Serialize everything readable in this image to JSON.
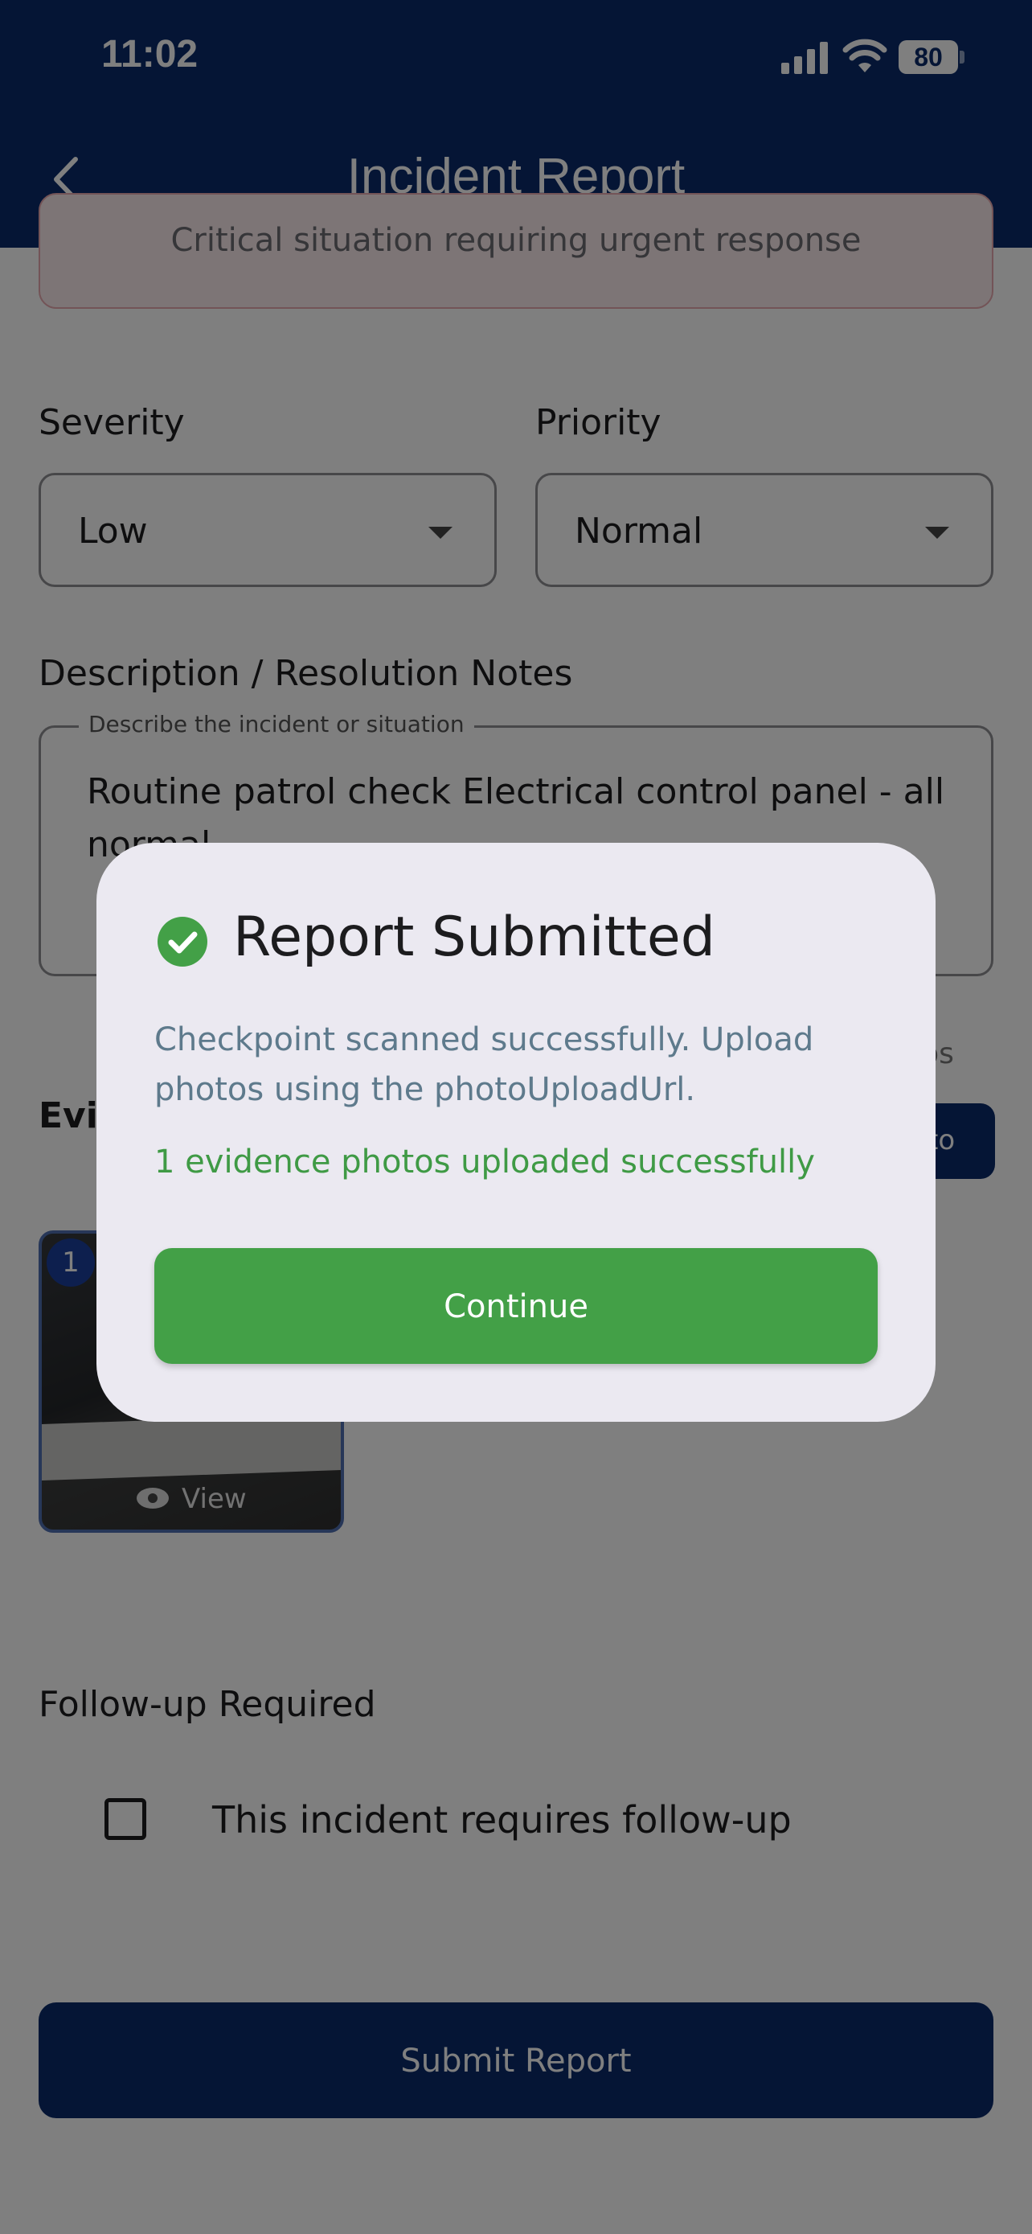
{
  "status_bar": {
    "time": "11:02",
    "battery": "80"
  },
  "header": {
    "title": "Incident Report"
  },
  "incident_type": {
    "description": "Critical situation requiring urgent response"
  },
  "severity": {
    "label": "Severity",
    "value": "Low"
  },
  "priority": {
    "label": "Priority",
    "value": "Normal"
  },
  "description": {
    "label": "Description / Resolution Notes",
    "legend": "Describe the incident or situation",
    "value": "Routine patrol check Electrical control panel - all normal"
  },
  "evidence": {
    "label": "Evi",
    "photos_hint": "otos",
    "add_photo_label": "to",
    "thumbnail": {
      "index": "1",
      "view_label": "View"
    }
  },
  "followup": {
    "label": "Follow-up Required",
    "checkbox_label": "This incident requires follow-up",
    "checked": false
  },
  "submit": {
    "label": "Submit Report"
  },
  "dialog": {
    "title": "Report Submitted",
    "message": "Checkpoint scanned successfully. Upload photos using the photoUploadUrl.",
    "success": "1 evidence photos uploaded successfully",
    "continue_label": "Continue"
  },
  "colors": {
    "header": "#0a2a6b",
    "success_green": "#43a047",
    "dialog_bg": "#ebe9f1"
  }
}
